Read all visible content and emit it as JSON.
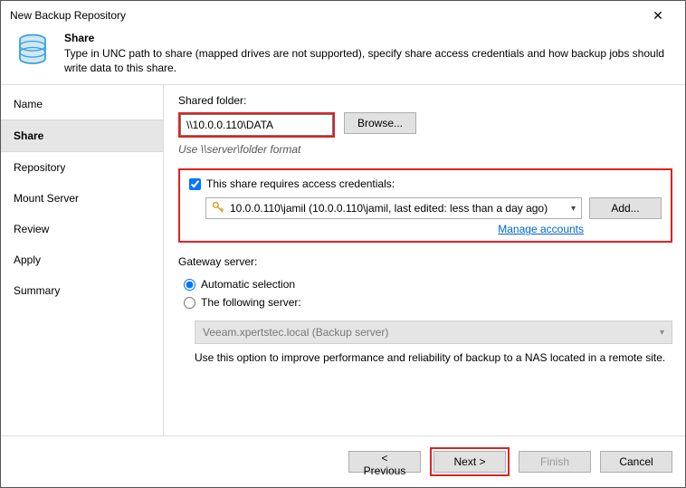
{
  "window": {
    "title": "New Backup Repository"
  },
  "header": {
    "title": "Share",
    "description": "Type in UNC path to share (mapped drives are not supported), specify share access credentials and how backup jobs should write data to this share."
  },
  "sidebar": {
    "items": [
      {
        "label": "Name"
      },
      {
        "label": "Share"
      },
      {
        "label": "Repository"
      },
      {
        "label": "Mount Server"
      },
      {
        "label": "Review"
      },
      {
        "label": "Apply"
      },
      {
        "label": "Summary"
      }
    ]
  },
  "content": {
    "shared_folder_label": "Shared folder:",
    "shared_folder_value": "\\\\10.0.0.110\\DATA",
    "browse_label": "Browse...",
    "format_hint": "Use \\\\server\\folder format",
    "cred_checkbox_label": "This share requires access credentials:",
    "cred_selected": "10.0.0.110\\jamil (10.0.0.110\\jamil, last edited: less than a day ago)",
    "add_label": "Add...",
    "manage_label": "Manage accounts",
    "gateway_label": "Gateway server:",
    "radio_auto": "Automatic selection",
    "radio_following": "The following server:",
    "server_value": "Veeam.xpertstec.local (Backup server)",
    "gateway_hint": "Use this option to improve performance and reliability of backup to a NAS located in a remote site."
  },
  "footer": {
    "previous": "< Previous",
    "next": "Next >",
    "finish": "Finish",
    "cancel": "Cancel"
  }
}
